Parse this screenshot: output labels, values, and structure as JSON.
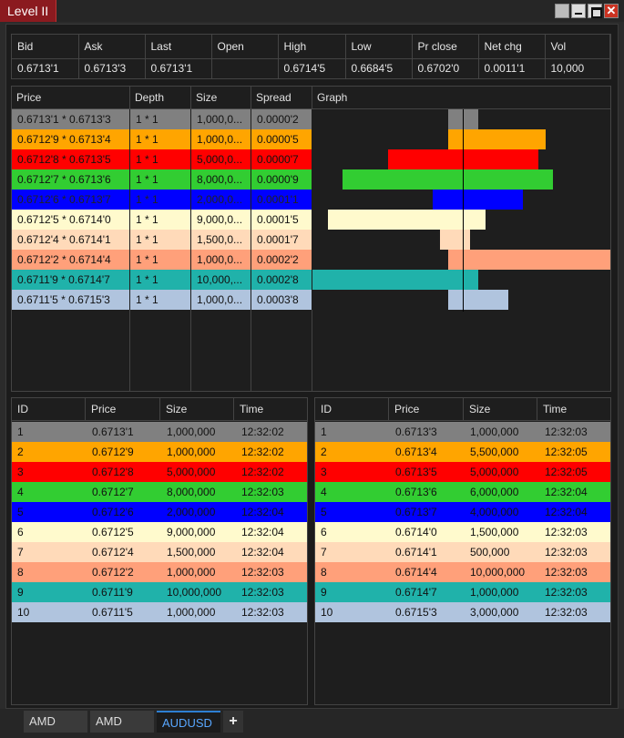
{
  "window": {
    "title": "Level II",
    "close_glyph": "✕"
  },
  "summary": {
    "headers": [
      "Bid",
      "Ask",
      "Last",
      "Open",
      "High",
      "Low",
      "Pr close",
      "Net chg",
      "Vol"
    ],
    "values": [
      "0.6713'1",
      "0.6713'3",
      "0.6713'1",
      "",
      "0.6714'5",
      "0.6684'5",
      "0.6702'0",
      "0.0011'1",
      "10,000"
    ]
  },
  "depth": {
    "headers": [
      "Price",
      "Depth",
      "Size",
      "Spread",
      "Graph"
    ],
    "rows": [
      {
        "price": "0.6713'1 * 0.6713'3",
        "depth": "1 * 1",
        "size": "1,000,0...",
        "spread": "0.0000'2",
        "color": "#808080"
      },
      {
        "price": "0.6712'9 * 0.6713'4",
        "depth": "1 * 1",
        "size": "1,000,0...",
        "spread": "0.0000'5",
        "color": "#ffa500"
      },
      {
        "price": "0.6712'8 * 0.6713'5",
        "depth": "1 * 1",
        "size": "5,000,0...",
        "spread": "0.0000'7",
        "color": "#ff0000"
      },
      {
        "price": "0.6712'7 * 0.6713'6",
        "depth": "1 * 1",
        "size": "8,000,0...",
        "spread": "0.0000'9",
        "color": "#32cd32"
      },
      {
        "price": "0.6712'6 * 0.6713'7",
        "depth": "1 * 1",
        "size": "2,000,0...",
        "spread": "0.0001'1",
        "color": "#0000ff"
      },
      {
        "price": "0.6712'5 * 0.6714'0",
        "depth": "1 * 1",
        "size": "9,000,0...",
        "spread": "0.0001'5",
        "color": "#fffacd"
      },
      {
        "price": "0.6712'4 * 0.6714'1",
        "depth": "1 * 1",
        "size": "1,500,0...",
        "spread": "0.0001'7",
        "color": "#ffdab9"
      },
      {
        "price": "0.6712'2 * 0.6714'4",
        "depth": "1 * 1",
        "size": "1,000,0...",
        "spread": "0.0002'2",
        "color": "#ffa07a"
      },
      {
        "price": "0.6711'9 * 0.6714'7",
        "depth": "1 * 1",
        "size": "10,000,...",
        "spread": "0.0002'8",
        "color": "#20b2aa"
      },
      {
        "price": "0.6711'5 * 0.6715'3",
        "depth": "1 * 1",
        "size": "1,000,0...",
        "spread": "0.0003'8",
        "color": "#b0c4de"
      }
    ],
    "graph_bars_millions": [
      {
        "bid": 1.0,
        "ask": 1.0
      },
      {
        "bid": 1.0,
        "ask": 5.5
      },
      {
        "bid": 5.0,
        "ask": 5.0
      },
      {
        "bid": 8.0,
        "ask": 6.0
      },
      {
        "bid": 2.0,
        "ask": 4.0
      },
      {
        "bid": 9.0,
        "ask": 1.5
      },
      {
        "bid": 1.5,
        "ask": 0.5
      },
      {
        "bid": 1.0,
        "ask": 10.0
      },
      {
        "bid": 10.0,
        "ask": 1.0
      },
      {
        "bid": 1.0,
        "ask": 3.0
      }
    ]
  },
  "bids": {
    "headers": [
      "ID",
      "Price",
      "Size",
      "Time"
    ],
    "rows": [
      [
        "1",
        "0.6713'1",
        "1,000,000",
        "12:32:02"
      ],
      [
        "2",
        "0.6712'9",
        "1,000,000",
        "12:32:02"
      ],
      [
        "3",
        "0.6712'8",
        "5,000,000",
        "12:32:02"
      ],
      [
        "4",
        "0.6712'7",
        "8,000,000",
        "12:32:03"
      ],
      [
        "5",
        "0.6712'6",
        "2,000,000",
        "12:32:04"
      ],
      [
        "6",
        "0.6712'5",
        "9,000,000",
        "12:32:04"
      ],
      [
        "7",
        "0.6712'4",
        "1,500,000",
        "12:32:04"
      ],
      [
        "8",
        "0.6712'2",
        "1,000,000",
        "12:32:03"
      ],
      [
        "9",
        "0.6711'9",
        "10,000,000",
        "12:32:03"
      ],
      [
        "10",
        "0.6711'5",
        "1,000,000",
        "12:32:03"
      ]
    ]
  },
  "asks": {
    "headers": [
      "ID",
      "Price",
      "Size",
      "Time"
    ],
    "rows": [
      [
        "1",
        "0.6713'3",
        "1,000,000",
        "12:32:03"
      ],
      [
        "2",
        "0.6713'4",
        "5,500,000",
        "12:32:05"
      ],
      [
        "3",
        "0.6713'5",
        "5,000,000",
        "12:32:05"
      ],
      [
        "4",
        "0.6713'6",
        "6,000,000",
        "12:32:04"
      ],
      [
        "5",
        "0.6713'7",
        "4,000,000",
        "12:32:04"
      ],
      [
        "6",
        "0.6714'0",
        "1,500,000",
        "12:32:03"
      ],
      [
        "7",
        "0.6714'1",
        "500,000",
        "12:32:03"
      ],
      [
        "8",
        "0.6714'4",
        "10,000,000",
        "12:32:03"
      ],
      [
        "9",
        "0.6714'7",
        "1,000,000",
        "12:32:03"
      ],
      [
        "10",
        "0.6715'3",
        "3,000,000",
        "12:32:03"
      ]
    ]
  },
  "row_colors": [
    "#808080",
    "#ffa500",
    "#ff0000",
    "#32cd32",
    "#0000ff",
    "#fffacd",
    "#ffdab9",
    "#ffa07a",
    "#20b2aa",
    "#b0c4de"
  ],
  "tabs": [
    {
      "label": "AMD",
      "active": false
    },
    {
      "label": "AMD",
      "active": false
    },
    {
      "label": "AUDUSD",
      "active": true
    }
  ],
  "add_tab_label": "+"
}
